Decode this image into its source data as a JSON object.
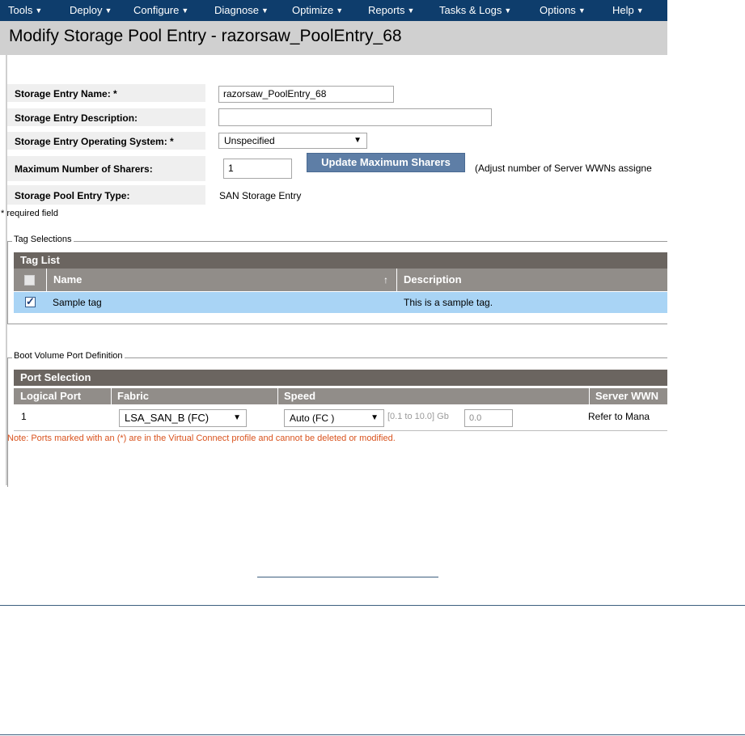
{
  "menu": [
    {
      "label": "Tools"
    },
    {
      "label": "Deploy"
    },
    {
      "label": "Configure"
    },
    {
      "label": "Diagnose"
    },
    {
      "label": "Optimize"
    },
    {
      "label": "Reports"
    },
    {
      "label": "Tasks & Logs"
    },
    {
      "label": "Options"
    },
    {
      "label": "Help"
    }
  ],
  "page_title": "Modify Storage Pool Entry - razorsaw_PoolEntry_68",
  "form": {
    "name_label": "Storage Entry Name: *",
    "name_value": "razorsaw_PoolEntry_68",
    "description_label": "Storage Entry Description:",
    "description_value": "",
    "os_label": "Storage Entry Operating System: *",
    "os_value": "Unspecified",
    "max_sharers_label": "Maximum Number of Sharers:",
    "max_sharers_value": "1",
    "update_button": "Update Maximum Sharers",
    "update_hint": "(Adjust number of Server WWNs assigne",
    "type_label": "Storage Pool Entry Type:",
    "type_value": "SAN Storage Entry",
    "required_note": "* required field"
  },
  "tags": {
    "legend": "Tag Selections",
    "table_title": "Tag List",
    "col_name": "Name",
    "col_sort_icon": "↑",
    "col_description": "Description",
    "rows": [
      {
        "name": "Sample tag",
        "description": "This is a sample tag.",
        "checked": true
      }
    ]
  },
  "boot": {
    "legend": "Boot Volume Port Definition",
    "table_title": "Port Selection",
    "col_port": "Logical Port",
    "col_fabric": "Fabric",
    "col_speed": "Speed",
    "col_wwn": "Server WWN",
    "row": {
      "port": "1",
      "fabric": "LSA_SAN_B (FC)",
      "speed": "Auto (FC )",
      "range": "[0.1 to 10.0] Gb",
      "speed_value": "0.0",
      "wwn": "Refer to Mana"
    },
    "note": "Note: Ports marked with an (*) are in the Virtual Connect profile and cannot be deleted or modified."
  },
  "colors": {
    "menu_bg": "#0e3d6c",
    "header_bg": "#6b6560",
    "selected_row": "#a9d4f5",
    "note": "#d9531e"
  }
}
